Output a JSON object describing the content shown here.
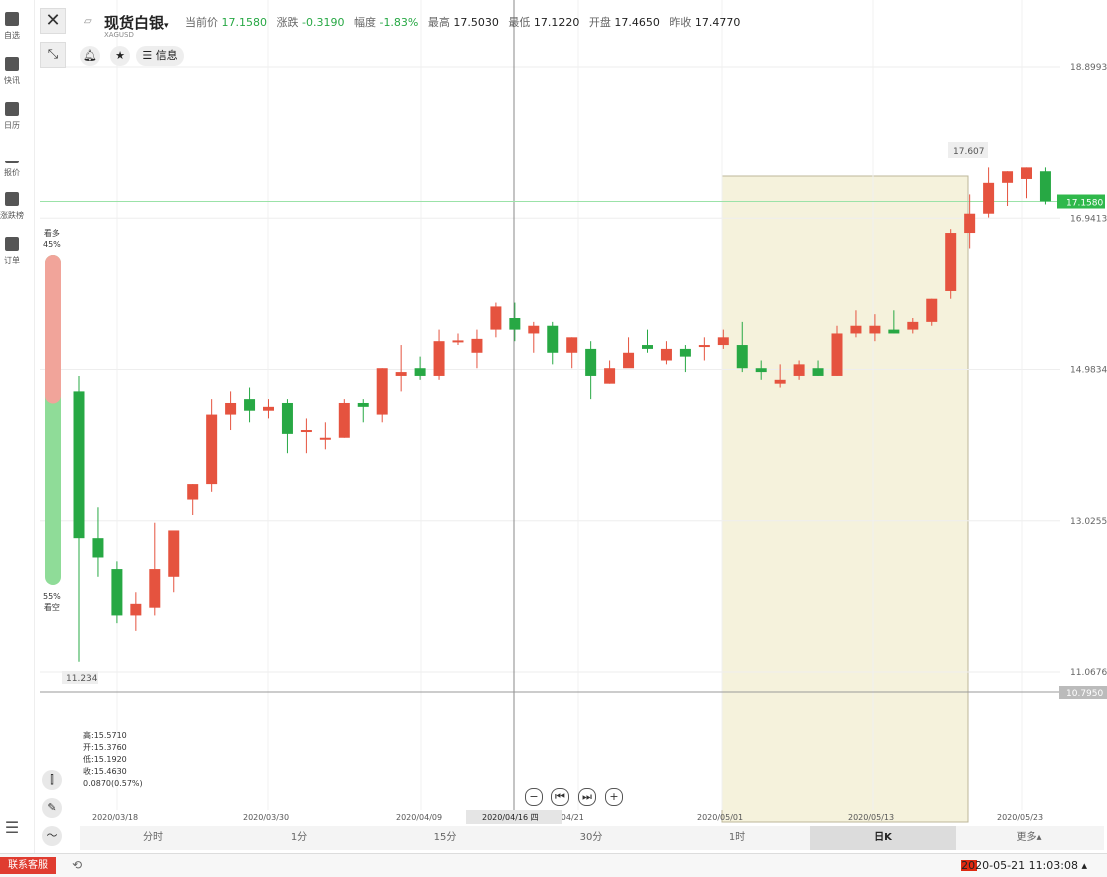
{
  "sidebar": {
    "items": [
      {
        "label": "自选",
        "icon": "bookmark-plus-icon"
      },
      {
        "label": "快讯",
        "icon": "news-list-icon"
      },
      {
        "label": "日历",
        "icon": "calendar-icon"
      },
      {
        "label": "报价",
        "icon": "line-chart-icon"
      },
      {
        "label": "涨跌榜",
        "icon": "bar-chart-icon"
      },
      {
        "label": "订单",
        "icon": "clipboard-icon"
      }
    ]
  },
  "header": {
    "symbol_name": "现货白银",
    "symbol_code": "XAGUSD",
    "quote": {
      "price_label": "当前价",
      "price": "17.1580",
      "change_label": "涨跌",
      "change": "-0.3190",
      "range_label": "幅度",
      "range": "-1.83%",
      "high_label": "最高",
      "high": "17.5030",
      "low_label": "最低",
      "low": "17.1220",
      "open_label": "开盘",
      "open": "17.4650",
      "prev_label": "昨收",
      "prev": "17.4770"
    },
    "info_label": "信息"
  },
  "sentiment": {
    "bull_label": "看多",
    "bull_pct": "45%",
    "bear_pct": "55%",
    "bear_label": "看空",
    "bull_fraction": 0.45
  },
  "ohlc_panel": {
    "high": "高:15.5710",
    "open": "开:15.3760",
    "low": "低:15.1920",
    "close": "收:15.4630",
    "change": "0.0870(0.57%)"
  },
  "crosshair_date": "2020/04/16 四",
  "periods": [
    {
      "label": "分时",
      "active": false
    },
    {
      "label": "1分",
      "active": false
    },
    {
      "label": "15分",
      "active": false
    },
    {
      "label": "30分",
      "active": false
    },
    {
      "label": "1时",
      "active": false
    },
    {
      "label": "日K",
      "active": true
    },
    {
      "label": "更多▴",
      "active": false
    }
  ],
  "footer": {
    "contact_label": "联系客服",
    "datetime": "2020-05-21 11:03:08 ▴"
  },
  "colors": {
    "up": "#e5533f",
    "down": "#27a844",
    "highlight": "#f5f2dc",
    "price_line": "#2fb84b"
  },
  "chart_data": {
    "type": "candlestick",
    "y_ticks": [
      "18.8993",
      "16.9413",
      "14.9834",
      "13.0255",
      "11.0676"
    ],
    "y_range": [
      10.0,
      19.5
    ],
    "x_ticks": [
      "2020/03/18",
      "2020/03/30",
      "2020/04/09",
      "0/04/21",
      "2020/05/01",
      "2020/05/13",
      "2020/05/23"
    ],
    "current_price_tag": "17.1580",
    "crosshair_price_tag": "10.7950",
    "min_tag": "11.234",
    "max_tag": "17.607",
    "candles": [
      {
        "o": 14.7,
        "h": 14.9,
        "l": 11.2,
        "c": 12.8
      },
      {
        "o": 12.8,
        "h": 13.2,
        "l": 12.3,
        "c": 12.55
      },
      {
        "o": 12.4,
        "h": 12.5,
        "l": 11.7,
        "c": 11.8
      },
      {
        "o": 11.8,
        "h": 12.1,
        "l": 11.6,
        "c": 11.95
      },
      {
        "o": 11.9,
        "h": 13.0,
        "l": 11.8,
        "c": 12.4
      },
      {
        "o": 12.3,
        "h": 12.6,
        "l": 12.1,
        "c": 12.9
      },
      {
        "o": 13.3,
        "h": 13.5,
        "l": 13.1,
        "c": 13.5
      },
      {
        "o": 13.5,
        "h": 14.6,
        "l": 13.4,
        "c": 14.4
      },
      {
        "o": 14.4,
        "h": 14.7,
        "l": 14.2,
        "c": 14.55
      },
      {
        "o": 14.6,
        "h": 14.75,
        "l": 14.3,
        "c": 14.45
      },
      {
        "o": 14.45,
        "h": 14.6,
        "l": 14.35,
        "c": 14.5
      },
      {
        "o": 14.55,
        "h": 14.6,
        "l": 13.9,
        "c": 14.15
      },
      {
        "o": 14.2,
        "h": 14.35,
        "l": 13.9,
        "c": 14.2
      },
      {
        "o": 14.1,
        "h": 14.3,
        "l": 13.95,
        "c": 14.1
      },
      {
        "o": 14.1,
        "h": 14.6,
        "l": 14.1,
        "c": 14.55
      },
      {
        "o": 14.55,
        "h": 14.6,
        "l": 14.3,
        "c": 14.5
      },
      {
        "o": 14.4,
        "h": 15.0,
        "l": 14.3,
        "c": 15.0
      },
      {
        "o": 14.9,
        "h": 15.3,
        "l": 14.7,
        "c": 14.95
      },
      {
        "o": 15.0,
        "h": 15.15,
        "l": 14.85,
        "c": 14.9
      },
      {
        "o": 14.9,
        "h": 15.5,
        "l": 14.85,
        "c": 15.35
      },
      {
        "o": 15.35,
        "h": 15.45,
        "l": 15.3,
        "c": 15.36
      },
      {
        "o": 15.2,
        "h": 15.5,
        "l": 15.0,
        "c": 15.38
      },
      {
        "o": 15.5,
        "h": 15.85,
        "l": 15.4,
        "c": 15.8
      },
      {
        "o": 15.65,
        "h": 15.85,
        "l": 15.35,
        "c": 15.5
      },
      {
        "o": 15.45,
        "h": 15.6,
        "l": 15.2,
        "c": 15.55
      },
      {
        "o": 15.55,
        "h": 15.6,
        "l": 15.05,
        "c": 15.2
      },
      {
        "o": 15.2,
        "h": 15.4,
        "l": 15.0,
        "c": 15.4
      },
      {
        "o": 15.25,
        "h": 15.35,
        "l": 14.6,
        "c": 14.9
      },
      {
        "o": 14.8,
        "h": 15.1,
        "l": 14.8,
        "c": 15.0
      },
      {
        "o": 15.0,
        "h": 15.4,
        "l": 15.05,
        "c": 15.2
      },
      {
        "o": 15.3,
        "h": 15.5,
        "l": 15.2,
        "c": 15.25
      },
      {
        "o": 15.1,
        "h": 15.35,
        "l": 15.05,
        "c": 15.25
      },
      {
        "o": 15.25,
        "h": 15.3,
        "l": 14.95,
        "c": 15.15
      },
      {
        "o": 15.3,
        "h": 15.4,
        "l": 15.1,
        "c": 15.3
      },
      {
        "o": 15.3,
        "h": 15.5,
        "l": 15.25,
        "c": 15.4
      },
      {
        "o": 15.3,
        "h": 15.6,
        "l": 14.95,
        "c": 15.0
      },
      {
        "o": 15.0,
        "h": 15.1,
        "l": 14.85,
        "c": 14.95
      },
      {
        "o": 14.8,
        "h": 15.05,
        "l": 14.75,
        "c": 14.85
      },
      {
        "o": 14.9,
        "h": 15.1,
        "l": 14.85,
        "c": 15.05
      },
      {
        "o": 15.0,
        "h": 15.1,
        "l": 14.9,
        "c": 14.9
      },
      {
        "o": 14.9,
        "h": 15.55,
        "l": 14.9,
        "c": 15.45
      },
      {
        "o": 15.45,
        "h": 15.75,
        "l": 15.4,
        "c": 15.55
      },
      {
        "o": 15.45,
        "h": 15.7,
        "l": 15.35,
        "c": 15.55
      },
      {
        "o": 15.5,
        "h": 15.75,
        "l": 15.45,
        "c": 15.45
      },
      {
        "o": 15.5,
        "h": 15.65,
        "l": 15.45,
        "c": 15.6
      },
      {
        "o": 15.6,
        "h": 15.9,
        "l": 15.55,
        "c": 15.9
      },
      {
        "o": 16.0,
        "h": 16.8,
        "l": 15.9,
        "c": 16.75
      },
      {
        "o": 16.75,
        "h": 17.25,
        "l": 16.55,
        "c": 17.0
      },
      {
        "o": 17.0,
        "h": 17.6,
        "l": 16.95,
        "c": 17.4
      },
      {
        "o": 17.4,
        "h": 17.55,
        "l": 17.1,
        "c": 17.55
      },
      {
        "o": 17.45,
        "h": 17.6,
        "l": 17.2,
        "c": 17.6
      },
      {
        "o": 17.55,
        "h": 17.6,
        "l": 17.12,
        "c": 17.16
      }
    ]
  }
}
